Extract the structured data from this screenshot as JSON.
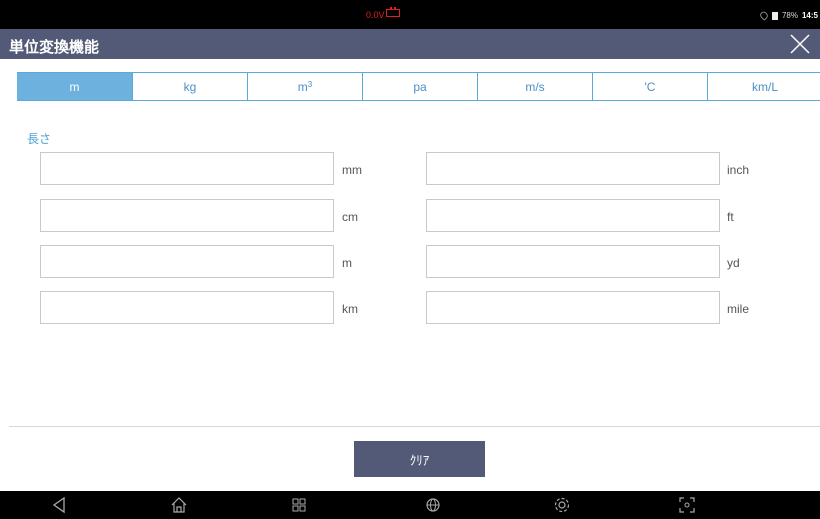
{
  "status": {
    "voltage": "0.0V",
    "battery": "78%",
    "time": "14:5"
  },
  "title": "単位変換機能",
  "tabs": [
    {
      "label": "m",
      "sup": "",
      "active": true
    },
    {
      "label": "kg",
      "sup": ""
    },
    {
      "label": "m",
      "sup": "3"
    },
    {
      "label": "pa",
      "sup": ""
    },
    {
      "label": "m/s",
      "sup": ""
    },
    {
      "label": "'C",
      "sup": ""
    },
    {
      "label": "km/L",
      "sup": ""
    }
  ],
  "section_label": "長さ",
  "left_fields": [
    {
      "unit": "mm",
      "value": ""
    },
    {
      "unit": "cm",
      "value": ""
    },
    {
      "unit": "m",
      "value": ""
    },
    {
      "unit": "km",
      "value": ""
    }
  ],
  "right_fields": [
    {
      "unit": "inch",
      "value": ""
    },
    {
      "unit": "ft",
      "value": ""
    },
    {
      "unit": "yd",
      "value": ""
    },
    {
      "unit": "mile",
      "value": ""
    }
  ],
  "clear_label": "ｸﾘｱ",
  "icons": {
    "close": "close-icon",
    "back": "back-icon",
    "home": "home-icon",
    "recent": "recent-apps-icon",
    "browser": "globe-icon",
    "settings": "gear-icon",
    "screenshot": "screenshot-icon"
  },
  "colors": {
    "accent": "#6db1de",
    "header": "#525a78",
    "warning": "#e02020"
  }
}
